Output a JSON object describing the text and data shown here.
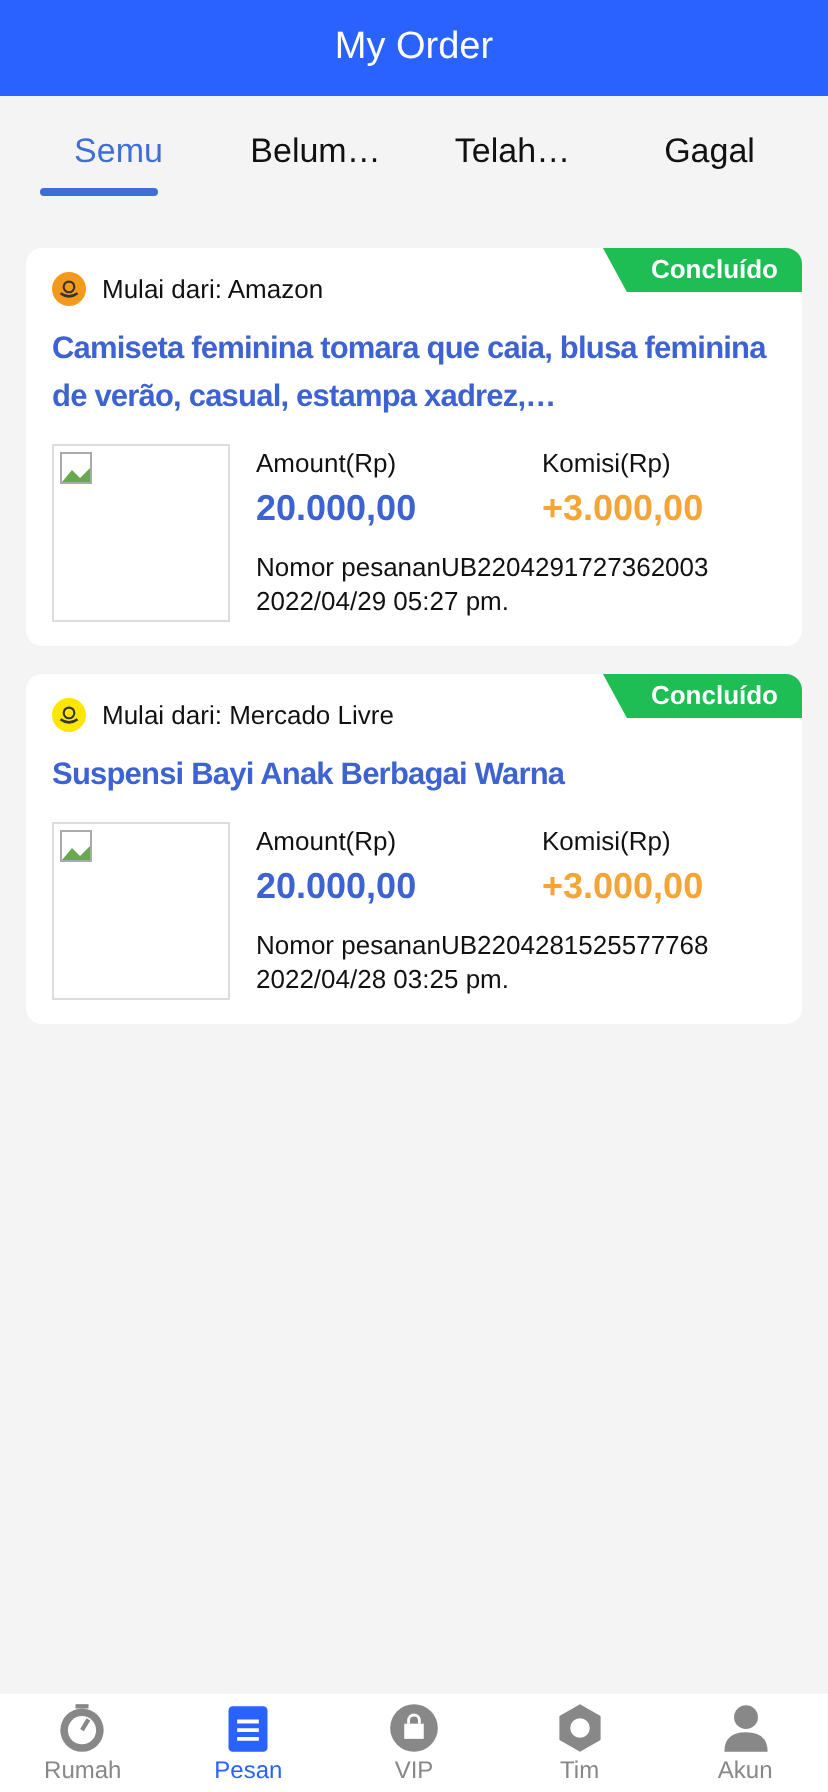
{
  "header": {
    "title": "My Order"
  },
  "tabs": [
    {
      "label": "Semu",
      "selected": true
    },
    {
      "label": "Belum…",
      "selected": false
    },
    {
      "label": "Telah…",
      "selected": false
    },
    {
      "label": "Gagal",
      "selected": false
    }
  ],
  "orders": [
    {
      "status": "Concluído",
      "source": "Mulai dari: Amazon",
      "color": "#f39a1d",
      "title": "Camiseta feminina tomara que caia, blusa feminina de verão, casual, estampa xadrez,…",
      "amount_label": "Amount(Rp)",
      "amount": "20.000,00",
      "commission_label": "Komisi(Rp)",
      "commission": "+3.000,00",
      "order_number": "Nomor pesananUB2204291727362003",
      "date": "2022/04/29 05:27 pm."
    },
    {
      "status": "Concluído",
      "source": "Mulai dari: Mercado Livre",
      "color": "#ffe600",
      "title": "Suspensi Bayi Anak Berbagai Warna",
      "amount_label": "Amount(Rp)",
      "amount": "20.000,00",
      "commission_label": "Komisi(Rp)",
      "commission": "+3.000,00",
      "order_number": "Nomor pesananUB2204281525577768",
      "date": "2022/04/28 03:25 pm."
    }
  ],
  "nav": [
    {
      "kind": "home",
      "label": "Rumah",
      "selected": false
    },
    {
      "kind": "orders",
      "label": "Pesan",
      "selected": true
    },
    {
      "kind": "vip",
      "label": "VIP",
      "selected": false
    },
    {
      "kind": "team",
      "label": "Tim",
      "selected": false
    },
    {
      "kind": "account",
      "label": "Akun",
      "selected": false
    }
  ]
}
